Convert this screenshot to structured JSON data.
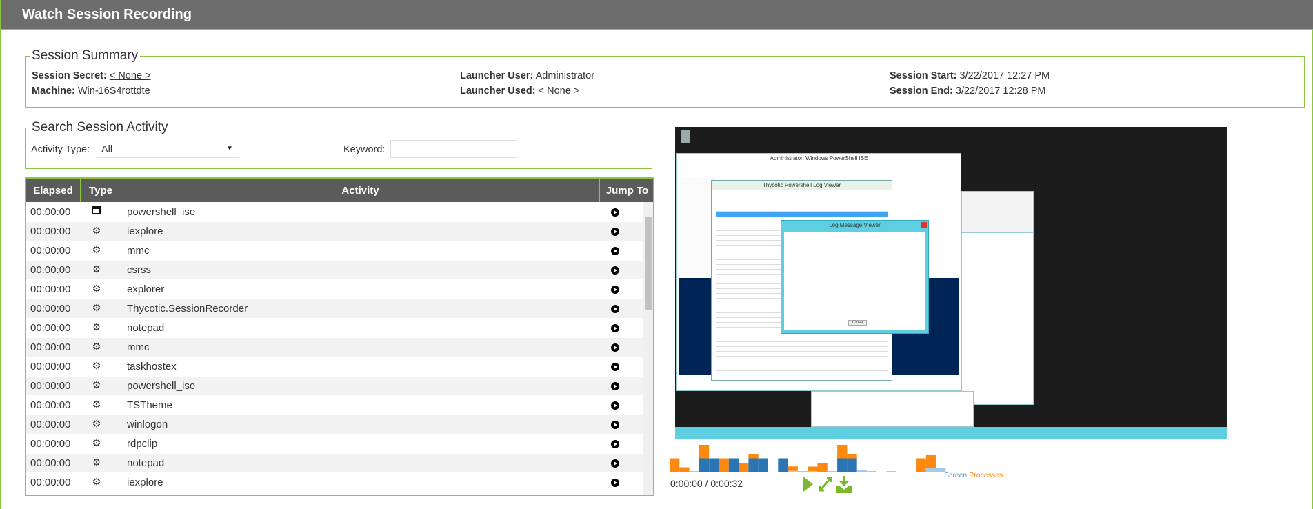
{
  "header": {
    "title": "Watch Session Recording"
  },
  "summary": {
    "legend": "Session Summary",
    "session_secret_label": "Session Secret:",
    "session_secret_value": "< None >",
    "machine_label": "Machine:",
    "machine_value": "Win-16S4rottdte",
    "launcher_user_label": "Launcher User:",
    "launcher_user_value": "Administrator",
    "launcher_used_label": "Launcher Used:",
    "launcher_used_value": "< None >",
    "session_start_label": "Session Start:",
    "session_start_value": "3/22/2017 12:27 PM",
    "session_end_label": "Session End:",
    "session_end_value": "3/22/2017 12:28 PM"
  },
  "search": {
    "legend": "Search Session Activity",
    "activity_type_label": "Activity Type:",
    "activity_type_value": "All",
    "keyword_label": "Keyword:",
    "keyword_value": ""
  },
  "table": {
    "columns": [
      "Elapsed",
      "Type",
      "Activity",
      "Jump To"
    ],
    "rows": [
      {
        "elapsed": "00:00:00",
        "type": "window",
        "activity": "powershell_ise"
      },
      {
        "elapsed": "00:00:00",
        "type": "process",
        "activity": "iexplore"
      },
      {
        "elapsed": "00:00:00",
        "type": "process",
        "activity": "mmc"
      },
      {
        "elapsed": "00:00:00",
        "type": "process",
        "activity": "csrss"
      },
      {
        "elapsed": "00:00:00",
        "type": "process",
        "activity": "explorer"
      },
      {
        "elapsed": "00:00:00",
        "type": "process",
        "activity": "Thycotic.SessionRecorder"
      },
      {
        "elapsed": "00:00:00",
        "type": "process",
        "activity": "notepad"
      },
      {
        "elapsed": "00:00:00",
        "type": "process",
        "activity": "mmc"
      },
      {
        "elapsed": "00:00:00",
        "type": "process",
        "activity": "taskhostex"
      },
      {
        "elapsed": "00:00:00",
        "type": "process",
        "activity": "powershell_ise"
      },
      {
        "elapsed": "00:00:00",
        "type": "process",
        "activity": "TSTheme"
      },
      {
        "elapsed": "00:00:00",
        "type": "process",
        "activity": "winlogon"
      },
      {
        "elapsed": "00:00:00",
        "type": "process",
        "activity": "rdpclip"
      },
      {
        "elapsed": "00:00:00",
        "type": "process",
        "activity": "notepad"
      },
      {
        "elapsed": "00:00:00",
        "type": "process",
        "activity": "iexplore"
      }
    ]
  },
  "recording": {
    "windows": {
      "ise": "Administrator: Windows PowerShell ISE",
      "log_viewer": "Thycotic Powershell Log Viewer",
      "message_viewer": "Log Message Viewer",
      "close": "Close"
    }
  },
  "player": {
    "time": "0:00:00 / 0:00:32",
    "legend_screen": "Screen",
    "legend_processes": "Processes",
    "colors": {
      "screen": "#2a75b3",
      "processes": "#ff8811"
    },
    "activity": {
      "screen": [
        0,
        0,
        0.1,
        3,
        3,
        0,
        3,
        0,
        3,
        3,
        0,
        3,
        0.2,
        0.15,
        0.1,
        0,
        0.1,
        3,
        3,
        0.4,
        0.1,
        0,
        0.1,
        0,
        0,
        0,
        0.8,
        0.8
      ],
      "processes": [
        3,
        1,
        0,
        3,
        0,
        3,
        0,
        2,
        1,
        0,
        0,
        0,
        1,
        0,
        1,
        2,
        0,
        3,
        1,
        0,
        0,
        0,
        0,
        0,
        0,
        3,
        3,
        0
      ]
    },
    "controls": [
      "play-icon",
      "fullscreen-icon",
      "download-icon"
    ]
  }
}
